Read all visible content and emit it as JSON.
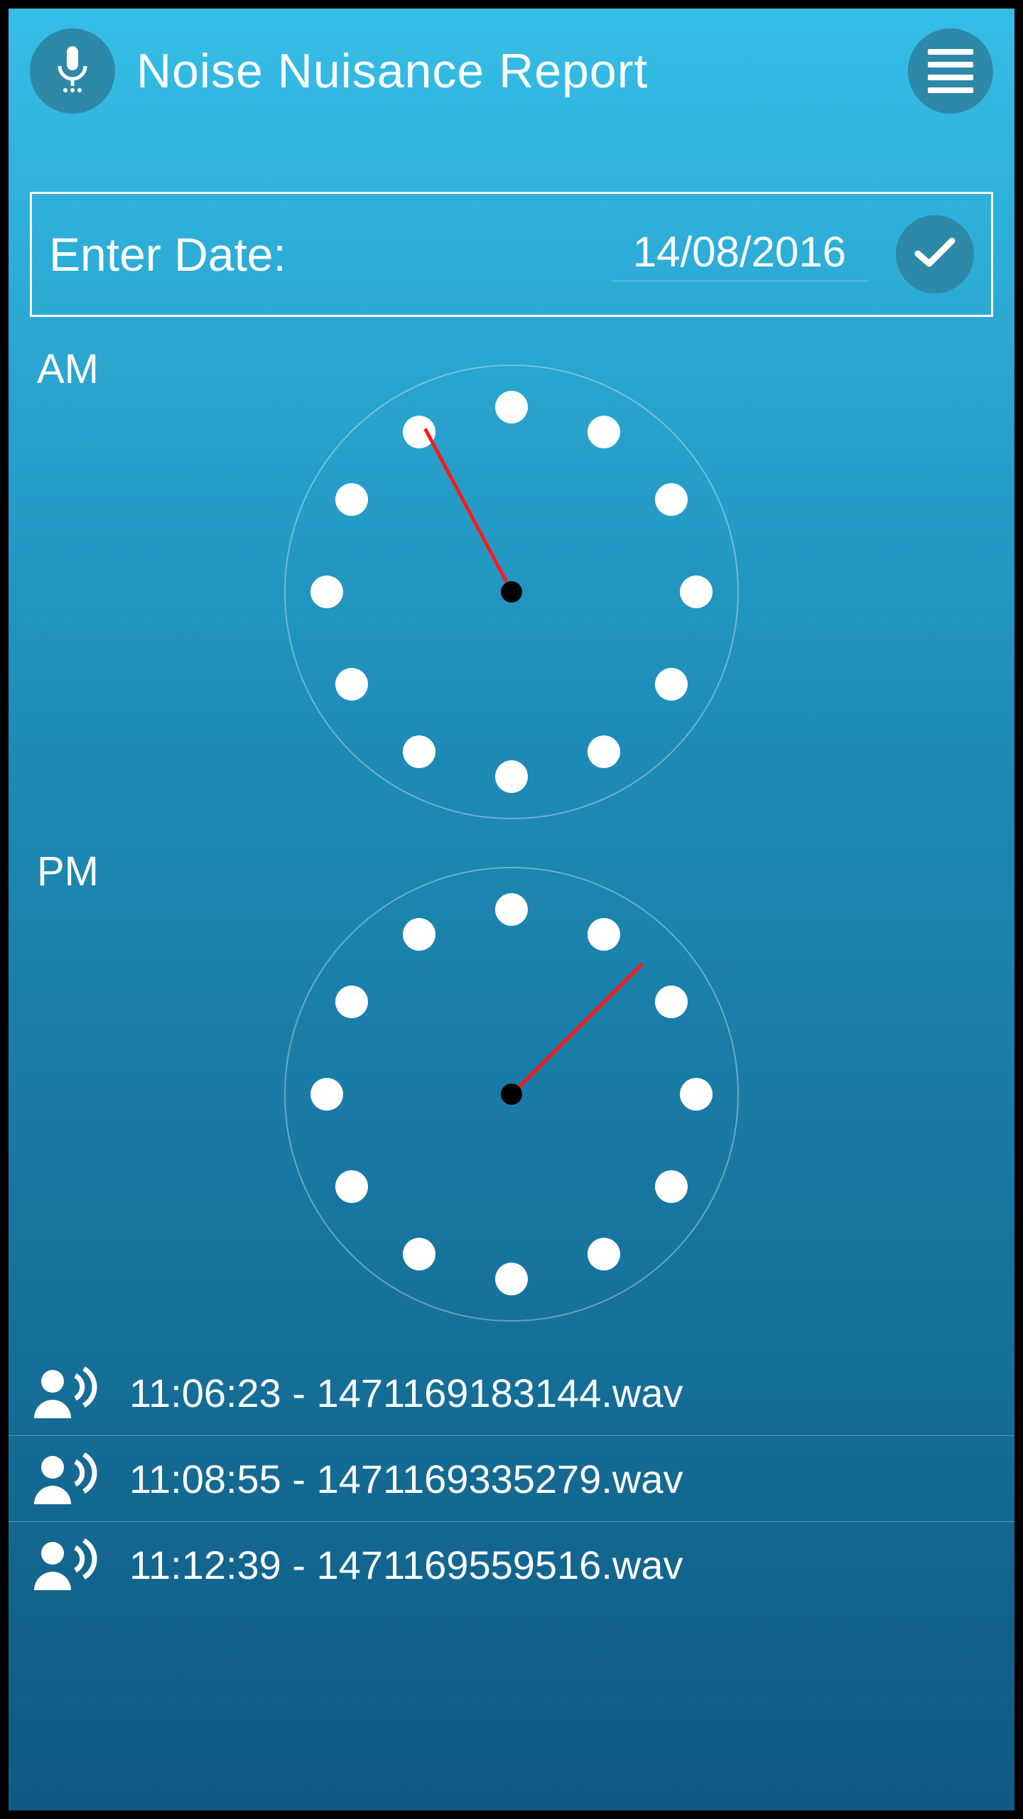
{
  "header": {
    "title": "Noise Nuisance Report"
  },
  "date": {
    "label": "Enter Date:",
    "value": "14/08/2016"
  },
  "periods": {
    "am_label": "AM",
    "pm_label": "PM"
  },
  "clocks": {
    "am_angle": -28,
    "pm_angle": 45
  },
  "recordings": [
    {
      "text": "11:06:23 - 1471169183144.wav"
    },
    {
      "text": "11:08:55 - 1471169335279.wav"
    },
    {
      "text": "11:12:39 - 1471169559516.wav"
    }
  ],
  "colors": {
    "accent": "#2e88a8"
  }
}
